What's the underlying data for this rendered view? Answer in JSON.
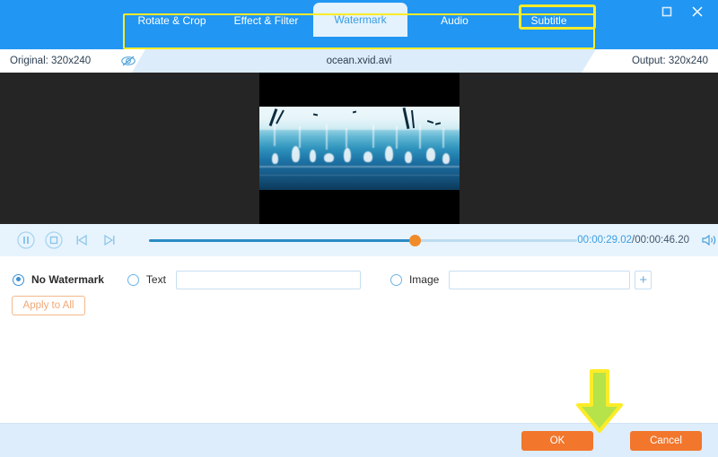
{
  "window": {
    "maximize_icon": "maximize-icon",
    "close_icon": "close-icon"
  },
  "tabs": [
    {
      "label": "Rotate & Crop",
      "active": false
    },
    {
      "label": "Effect & Filter",
      "active": false
    },
    {
      "label": "Watermark",
      "active": true
    },
    {
      "label": "Audio",
      "active": false
    },
    {
      "label": "Subtitle",
      "active": false
    }
  ],
  "infobar": {
    "original": "Original: 320x240",
    "filename": "ocean.xvid.avi",
    "output": "Output: 320x240",
    "toggle_preview_icon": "eye-slash-icon"
  },
  "player": {
    "pause_icon": "pause-icon",
    "stop_icon": "stop-icon",
    "prev_icon": "previous-frame-icon",
    "next_icon": "next-frame-icon",
    "volume_icon": "volume-icon",
    "current_time": "00:00:29.02",
    "separator": "/",
    "total_time": "00:00:46.20",
    "progress_percent": 62
  },
  "watermark": {
    "no_watermark_label": "No Watermark",
    "no_watermark_selected": true,
    "text_label": "Text",
    "text_selected": false,
    "text_value": "",
    "text_placeholder": "",
    "image_label": "Image",
    "image_selected": false,
    "image_value": "",
    "image_placeholder": "",
    "add_image_label": "+",
    "apply_to_all_label": "Apply to All"
  },
  "footer": {
    "ok_label": "OK",
    "cancel_label": "Cancel"
  },
  "annotations": {
    "arrow": "down-arrow-annotation",
    "tab_highlight": "tabbar-highlight-box",
    "ok_highlight": "ok-button-highlight-box"
  },
  "colors": {
    "brand_blue": "#2196f3",
    "accent_orange": "#f2762c",
    "highlight_yellow": "#fbec28",
    "panel_blue": "#e8f4fd",
    "slider_knob": "#f08b29"
  }
}
